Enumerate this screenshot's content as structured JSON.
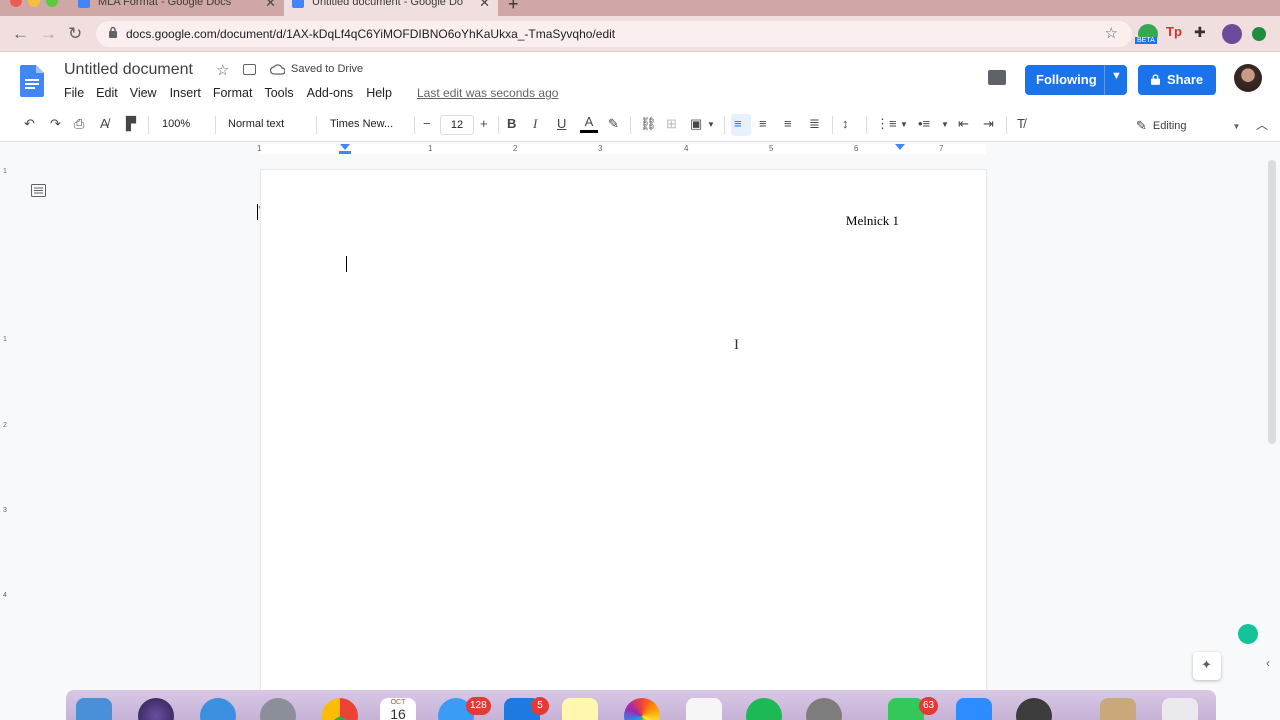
{
  "browser": {
    "tabs": [
      {
        "title": "MLA Format - Google Docs",
        "active": false
      },
      {
        "title": "Untitled document - Google Do",
        "active": true
      }
    ],
    "url": "docs.google.com/document/d/1AX-kDqLf4qC6YiMOFDIBNO6oYhKaUkxa_-TmaSyvqho/edit",
    "extension_badge": "BETA"
  },
  "docs": {
    "title": "Untitled document",
    "saved_status": "Saved to Drive",
    "menu": [
      "File",
      "Edit",
      "View",
      "Insert",
      "Format",
      "Tools",
      "Add-ons",
      "Help"
    ],
    "last_edit": "Last edit was seconds ago",
    "following_label": "Following",
    "share_label": "Share"
  },
  "toolbar": {
    "zoom": "100%",
    "style": "Normal text",
    "font": "Times New...",
    "font_size": "12",
    "minus": "−",
    "plus": "+",
    "bold": "B",
    "italic": "I",
    "underline": "U",
    "text_color": "A",
    "mode": "Editing"
  },
  "ruler": {
    "numbers": [
      "1",
      "1",
      "2",
      "3",
      "4",
      "5",
      "6",
      "7"
    ],
    "vertical_numbers": [
      "1",
      "1",
      "2",
      "3",
      "4"
    ]
  },
  "page": {
    "header": "Melnick 1"
  },
  "dock": {
    "badges": [
      "128",
      "5",
      "63"
    ],
    "calendar_month": "OCT",
    "calendar_day": "16"
  },
  "colors": {
    "accent": "#1a73e8",
    "tabbar": "#cfa7a7",
    "grammarly": "#15c39a"
  }
}
